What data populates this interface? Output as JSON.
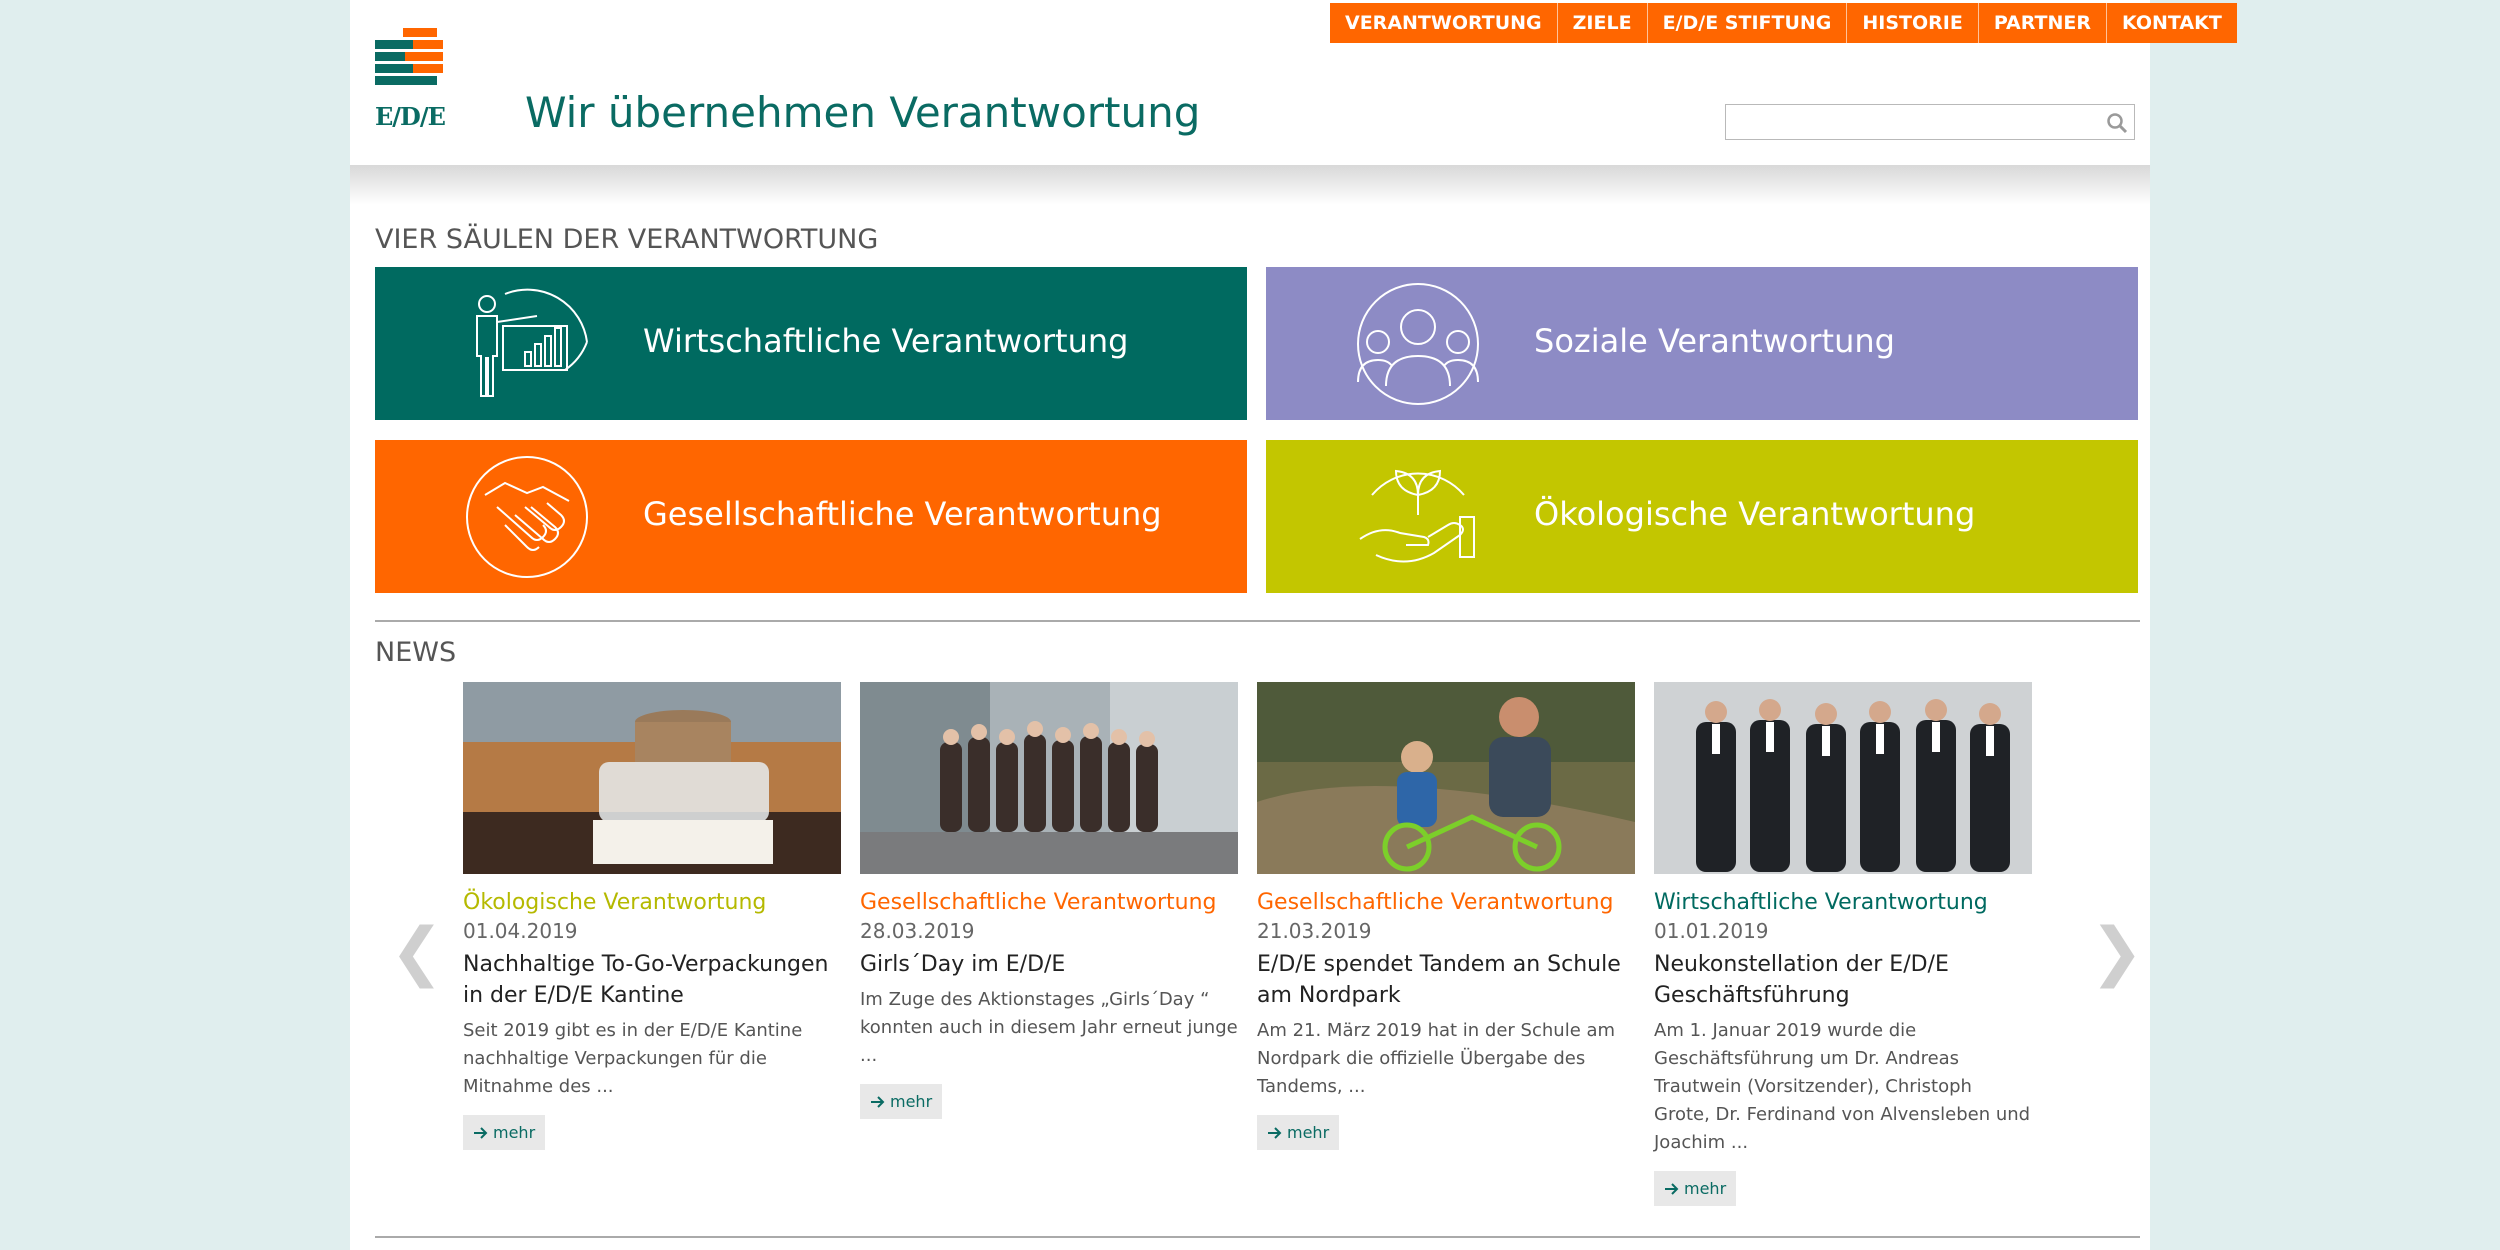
{
  "nav": {
    "items": [
      "VERANTWORTUNG",
      "ZIELE",
      "E/D/E STIFTUNG",
      "HISTORIE",
      "PARTNER",
      "KONTAKT"
    ]
  },
  "header": {
    "logo_text": "E/D/E",
    "title": "Wir übernehmen Verantwortung",
    "search_placeholder": ""
  },
  "pillars": {
    "heading": "VIER SÄULEN DER VERANTWORTUNG",
    "items": [
      {
        "label": "Wirtschaftliche Verantwortung",
        "color": "#006a60",
        "icon": "presenter-chart-icon"
      },
      {
        "label": "Soziale Verantwortung",
        "color": "#8d8bc5",
        "icon": "people-group-icon"
      },
      {
        "label": "Gesellschaftliche Verantwortung",
        "color": "#ff6600",
        "icon": "handshake-icon"
      },
      {
        "label": "Ökologische Verantwortung",
        "color": "#c3c600",
        "icon": "hand-plant-icon"
      }
    ]
  },
  "news": {
    "heading": "NEWS",
    "more_label": "mehr",
    "prev_arrow": "❮",
    "next_arrow": "❯",
    "items": [
      {
        "category": "Ökologische Verantwortung",
        "category_color": "#b5b900",
        "date": "01.04.2019",
        "title": "Nachhaltige To-Go-Verpackungen in der E/D/E Kantine",
        "text": "Seit 2019 gibt es in der E/D/E Kantine nachhaltige Verpackungen für die Mitnahme des ..."
      },
      {
        "category": "Gesellschaftliche Verantwortung",
        "category_color": "#ff6600",
        "date": "28.03.2019",
        "title": "Girls´Day im E/D/E",
        "text": "Im Zuge des Aktionstages „Girls´Day “ konnten auch in diesem Jahr erneut junge ..."
      },
      {
        "category": "Gesellschaftliche Verantwortung",
        "category_color": "#ff6600",
        "date": "21.03.2019",
        "title": "E/D/E spendet Tandem an Schule am Nordpark",
        "text": "Am 21. März 2019 hat in der Schule am Nordpark  die offizielle Übergabe des Tandems, ..."
      },
      {
        "category": "Wirtschaftliche Verantwortung",
        "category_color": "#006a60",
        "date": "01.01.2019",
        "title": "Neukonstellation der E/D/E Geschäftsführung",
        "text": "Am 1. Januar 2019 wurde die Geschäftsführung um Dr. Andreas Trautwein (Vorsitzender), Christoph Grote, Dr. Ferdinand von Alvensleben und Joachim ..."
      }
    ]
  },
  "colors": {
    "brand_teal": "#0a6b63",
    "brand_orange": "#ff6600"
  }
}
